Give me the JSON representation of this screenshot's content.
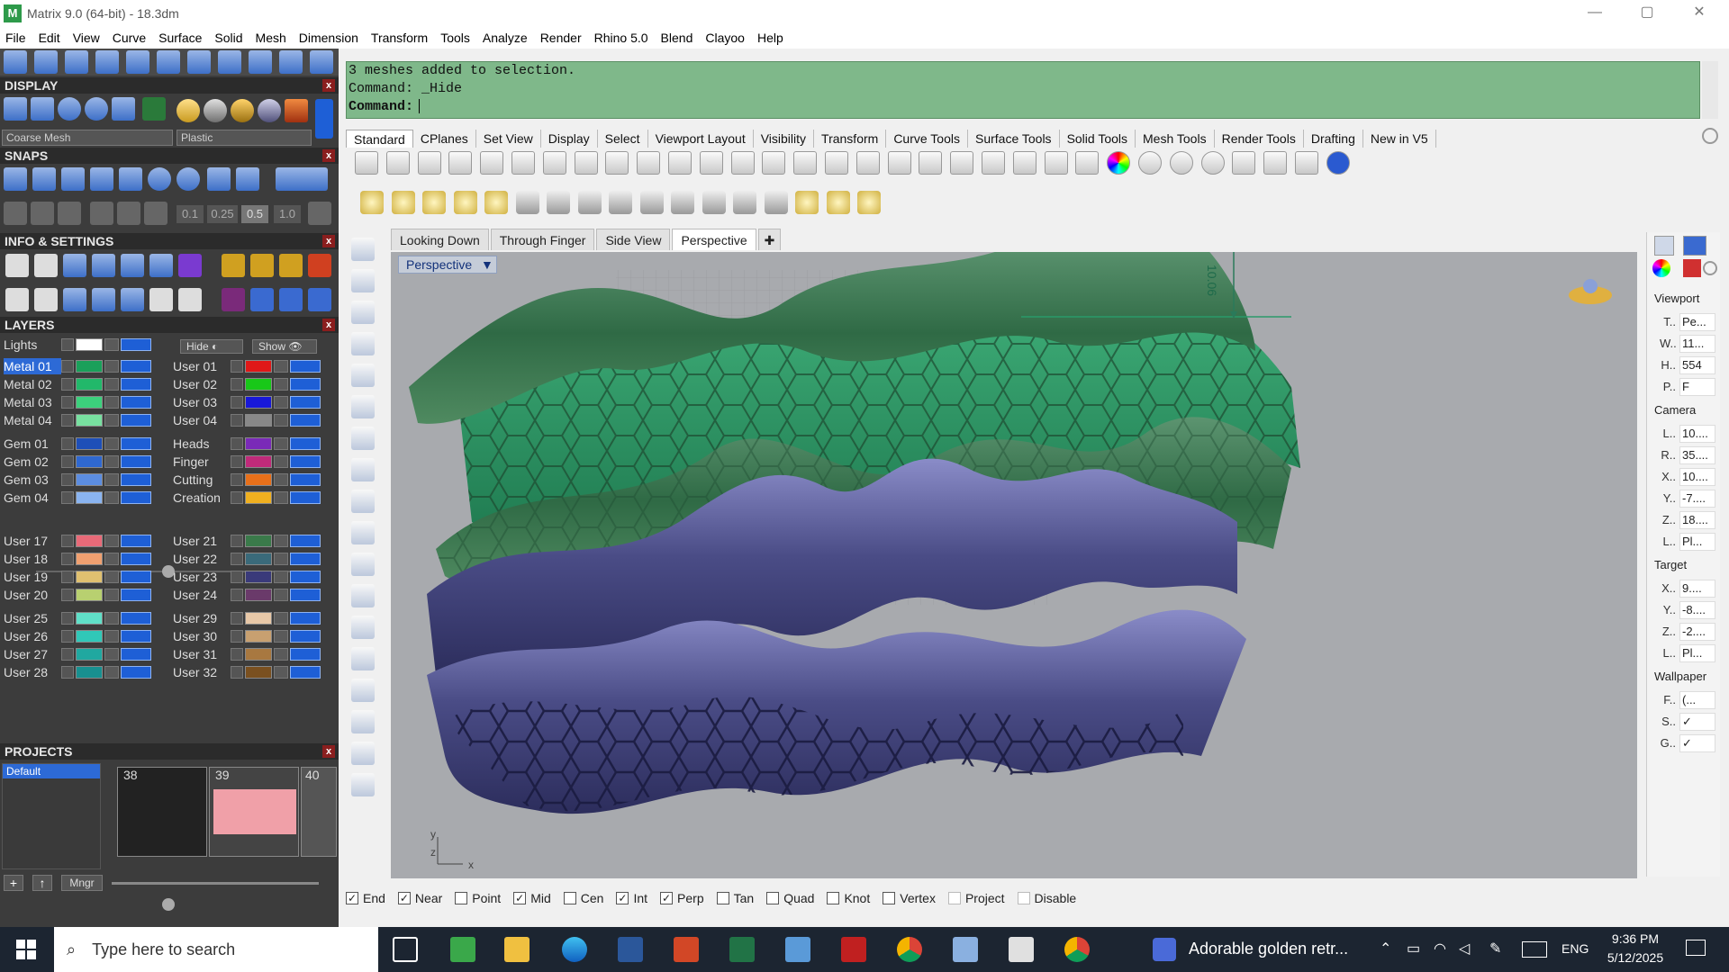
{
  "window": {
    "title": "Matrix 9.0 (64-bit) - 18.3dm",
    "app_icon": "matrix-app-icon",
    "controls": {
      "minimize": "—",
      "maximize": "▢",
      "close": "✕"
    }
  },
  "menu": [
    "File",
    "Edit",
    "View",
    "Curve",
    "Surface",
    "Solid",
    "Mesh",
    "Dimension",
    "Transform",
    "Tools",
    "Analyze",
    "Render",
    "Rhino 5.0",
    "Blend",
    "Clayoo",
    "Help"
  ],
  "left_panel": {
    "display": {
      "header": "DISPLAY",
      "mesh_dropdown": "Coarse Mesh",
      "material_dropdown": "Plastic"
    },
    "snaps": {
      "header": "SNAPS",
      "values": [
        "0.1",
        "0.25",
        "0.5",
        "1.0"
      ]
    },
    "info": {
      "header": "INFO & SETTINGS"
    },
    "layers": {
      "header": "LAYERS",
      "lights_label": "Lights",
      "hide_label": "Hide",
      "show_label": "Show",
      "left_column": [
        {
          "name": "Metal 01",
          "color": "#1aa05a",
          "selected": true
        },
        {
          "name": "Metal 02",
          "color": "#22b86a"
        },
        {
          "name": "Metal 03",
          "color": "#3cd07c"
        },
        {
          "name": "Metal 04",
          "color": "#78e0a0"
        },
        {
          "name": "Gem 01",
          "color": "#1e4fb8"
        },
        {
          "name": "Gem 02",
          "color": "#2f68d0"
        },
        {
          "name": "Gem 03",
          "color": "#5c8de0"
        },
        {
          "name": "Gem 04",
          "color": "#8ab4f0"
        },
        {
          "name": "User 17",
          "color": "#e86a78"
        },
        {
          "name": "User 18",
          "color": "#f0a070"
        },
        {
          "name": "User 19",
          "color": "#e0c070"
        },
        {
          "name": "User 20",
          "color": "#b8d070"
        },
        {
          "name": "User 25",
          "color": "#60e0c8"
        },
        {
          "name": "User 26",
          "color": "#30c8b8"
        },
        {
          "name": "User 27",
          "color": "#20a8a0"
        },
        {
          "name": "User 28",
          "color": "#189090"
        }
      ],
      "right_column": [
        {
          "name": "User 01",
          "color": "#e01818"
        },
        {
          "name": "User 02",
          "color": "#18c818"
        },
        {
          "name": "User 03",
          "color": "#1818d8"
        },
        {
          "name": "User 04",
          "color": "#888888"
        },
        {
          "name": "Heads",
          "color": "#7a2ab8"
        },
        {
          "name": "Finger",
          "color": "#c02a7a"
        },
        {
          "name": "Cutting",
          "color": "#e8701a"
        },
        {
          "name": "Creation",
          "color": "#f0b020"
        },
        {
          "name": "User 21",
          "color": "#3a7a4a"
        },
        {
          "name": "User 22",
          "color": "#3a6a7a"
        },
        {
          "name": "User 23",
          "color": "#3a3a7a"
        },
        {
          "name": "User 24",
          "color": "#6a3a6a"
        },
        {
          "name": "User 29",
          "color": "#e8c8a8"
        },
        {
          "name": "User 30",
          "color": "#c8a070"
        },
        {
          "name": "User 31",
          "color": "#a87840"
        },
        {
          "name": "User 32",
          "color": "#7a5020"
        }
      ]
    },
    "projects": {
      "header": "PROJECTS",
      "default_label": "Default",
      "thumbs": [
        "38",
        "39",
        "40"
      ],
      "mngr_label": "Mngr"
    }
  },
  "command": {
    "lines": [
      "3 meshes added to selection.",
      "Command: _Hide",
      "Command:"
    ]
  },
  "toolbar_tabs": [
    "Standard",
    "CPlanes",
    "Set View",
    "Display",
    "Select",
    "Viewport Layout",
    "Visibility",
    "Transform",
    "Curve Tools",
    "Surface Tools",
    "Solid Tools",
    "Mesh Tools",
    "Render Tools",
    "Drafting",
    "New in V5"
  ],
  "viewport_tabs": [
    "Looking Down",
    "Through Finger",
    "Side View",
    "Perspective"
  ],
  "viewport": {
    "label": "Perspective",
    "dimension": "10.06",
    "axis_labels": {
      "y": "y",
      "z": "z",
      "x": "x"
    }
  },
  "right_panel": {
    "viewport_section": "Viewport",
    "viewport_rows": [
      [
        "T..",
        "Pe..."
      ],
      [
        "W..",
        "11..."
      ],
      [
        "H..",
        "554"
      ],
      [
        "P..",
        "F"
      ]
    ],
    "camera_section": "Camera",
    "camera_rows": [
      [
        "L..",
        "10...."
      ],
      [
        "R..",
        "35...."
      ],
      [
        "X..",
        "10...."
      ],
      [
        "Y..",
        "-7...."
      ],
      [
        "Z..",
        "18...."
      ],
      [
        "L..",
        "Pl..."
      ]
    ],
    "target_section": "Target",
    "target_rows": [
      [
        "X..",
        "9...."
      ],
      [
        "Y..",
        "-8...."
      ],
      [
        "Z..",
        "-2...."
      ],
      [
        "L..",
        "Pl..."
      ]
    ],
    "wallpaper_section": "Wallpaper",
    "wallpaper_rows": [
      [
        "F..",
        "(..."
      ],
      [
        "S..",
        "✓"
      ],
      [
        "G..",
        "✓"
      ]
    ]
  },
  "osnaps": [
    {
      "label": "End",
      "checked": true
    },
    {
      "label": "Near",
      "checked": true
    },
    {
      "label": "Point",
      "checked": false
    },
    {
      "label": "Mid",
      "checked": true
    },
    {
      "label": "Cen",
      "checked": false
    },
    {
      "label": "Int",
      "checked": true
    },
    {
      "label": "Perp",
      "checked": true
    },
    {
      "label": "Tan",
      "checked": false
    },
    {
      "label": "Quad",
      "checked": false
    },
    {
      "label": "Knot",
      "checked": false
    },
    {
      "label": "Vertex",
      "checked": false
    },
    {
      "label": "Project",
      "checked": false,
      "disabled": true
    },
    {
      "label": "Disable",
      "checked": false,
      "disabled": true
    }
  ],
  "taskbar": {
    "search_placeholder": "Type here to search",
    "media_text": "Adorable golden retr...",
    "lang": "ENG",
    "time": "9:36 PM",
    "date": "5/12/2025"
  },
  "colors": {
    "command_bg": "#7fb88a",
    "green_ring": "#3f7a52",
    "purple_ring": "#4a4c86",
    "viewport_bg": "#a8aaae"
  }
}
